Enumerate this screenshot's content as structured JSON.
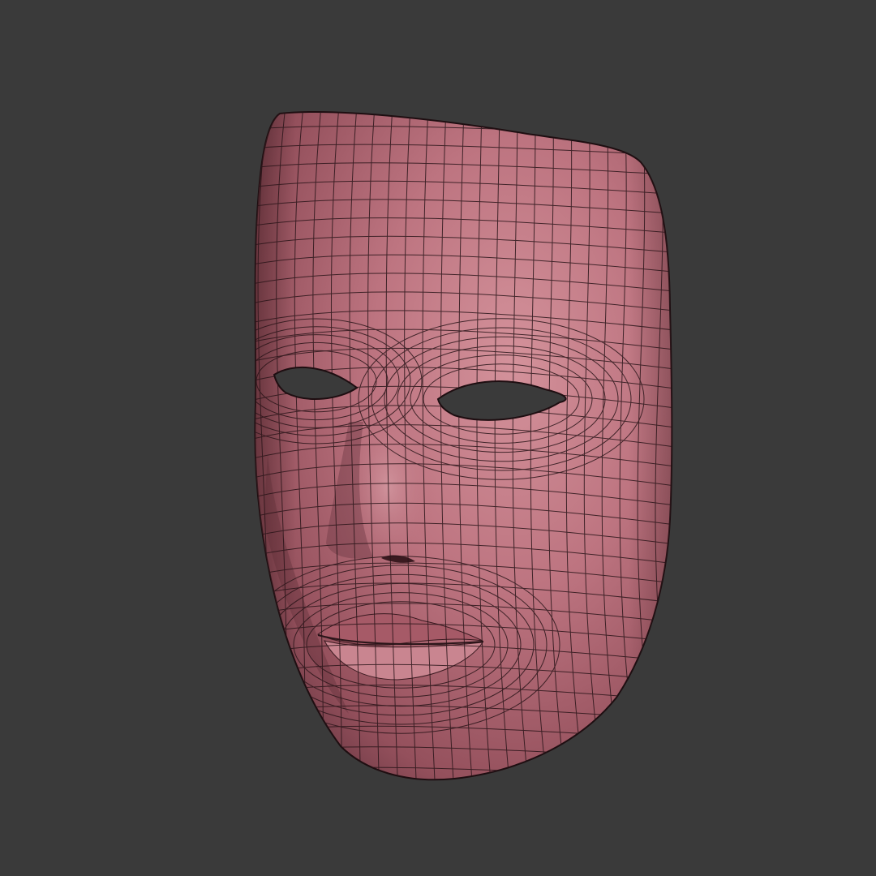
{
  "viewport": {
    "background_color": "#3a3a3a"
  },
  "model": {
    "name": "face-mask-mesh",
    "base_color": "#b86d7a",
    "highlight_color": "#d08a94",
    "shadow_color": "#6e3a45",
    "wire_color": "#2a1519",
    "show_wireframe": true,
    "eye_holes": true
  }
}
